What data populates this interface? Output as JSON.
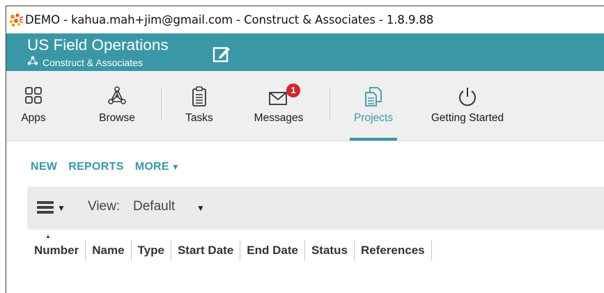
{
  "window": {
    "title": "DEMO - kahua.mah+jim@gmail.com - Construct & Associates - 1.8.9.88"
  },
  "header": {
    "title": "US Field Operations",
    "subtitle": "Construct & Associates",
    "color": "#3a97a6"
  },
  "nav": {
    "items": [
      {
        "label": "Apps",
        "icon": "apps-grid-icon"
      },
      {
        "label": "Browse",
        "icon": "browse-network-icon"
      },
      {
        "label": "Tasks",
        "icon": "clipboard-icon"
      },
      {
        "label": "Messages",
        "icon": "envelope-icon",
        "badge": "1"
      },
      {
        "label": "Projects",
        "icon": "projects-documents-icon",
        "active": true
      },
      {
        "label": "Getting Started",
        "icon": "power-icon"
      }
    ]
  },
  "actions": {
    "new_label": "NEW",
    "reports_label": "REPORTS",
    "more_label": "MORE"
  },
  "viewbar": {
    "view_label": "View:",
    "view_value": "Default"
  },
  "columns": [
    "Number",
    "Name",
    "Type",
    "Start Date",
    "End Date",
    "Status",
    "References"
  ],
  "colors": {
    "accent": "#3a97a6",
    "badge": "#d2262e"
  }
}
